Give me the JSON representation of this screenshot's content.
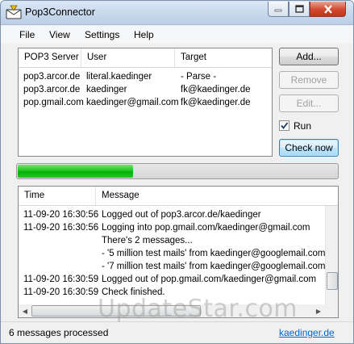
{
  "window": {
    "title": "Pop3Connector",
    "icon": "pop3connector-app-icon"
  },
  "menu": [
    "File",
    "View",
    "Settings",
    "Help"
  ],
  "servers": {
    "columns": [
      "POP3 Server",
      "User",
      "Target"
    ],
    "rows": [
      [
        "pop3.arcor.de",
        "literal.kaedinger",
        "- Parse -"
      ],
      [
        "pop3.arcor.de",
        "kaedinger",
        "fk@kaedinger.de"
      ],
      [
        "pop.gmail.com",
        "kaedinger@gmail.com",
        "fk@kaedinger.de"
      ]
    ]
  },
  "buttons": {
    "add": "Add...",
    "remove": "Remove",
    "edit": "Edit...",
    "check_now": "Check now"
  },
  "run": {
    "label": "Run",
    "checked": true
  },
  "progress": {
    "fraction": 0.36
  },
  "log": {
    "columns": [
      "Time",
      "Message"
    ],
    "rows": [
      [
        "11-09-20 16:30:56",
        "Logged out of pop3.arcor.de/kaedinger"
      ],
      [
        "11-09-20 16:30:56",
        "Logging into pop.gmail.com/kaedinger@gmail.com"
      ],
      [
        "",
        "There's 2 messages..."
      ],
      [
        "",
        "- '5 million test mails' from kaedinger@googlemail.com goin..."
      ],
      [
        "",
        "- '7 million test mails' from kaedinger@googlemail.com goin..."
      ],
      [
        "11-09-20 16:30:59",
        "Logged out of pop.gmail.com/kaedinger@gmail.com"
      ],
      [
        "11-09-20 16:30:59",
        "Check finished."
      ]
    ]
  },
  "status": {
    "text": "6 messages processed",
    "link": "kaedinger.de"
  },
  "watermark": "UpdateStar.com",
  "colors": {
    "progress_green": "#06b006",
    "link_blue": "#0066cc",
    "close_red": "#c1331b"
  }
}
